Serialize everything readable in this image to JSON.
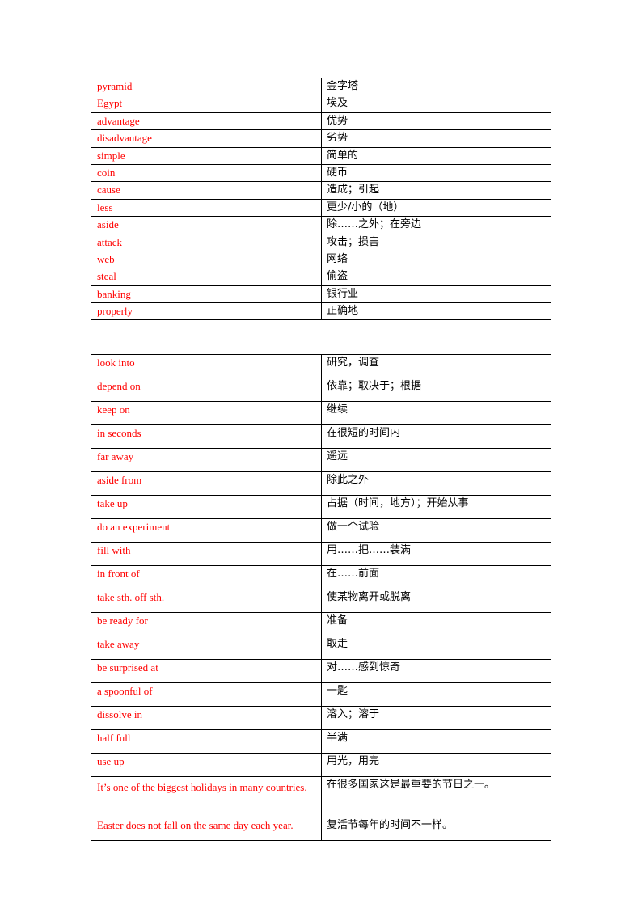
{
  "vocab_table": {
    "rows": [
      {
        "en": "pyramid",
        "zh": "金字塔"
      },
      {
        "en": "Egypt",
        "zh": "埃及"
      },
      {
        "en": "advantage",
        "zh": "优势"
      },
      {
        "en": "disadvantage",
        "zh": "劣势"
      },
      {
        "en": "simple",
        "zh": "简单的"
      },
      {
        "en": "coin",
        "zh": "硬币"
      },
      {
        "en": "cause",
        "zh": "造成；引起"
      },
      {
        "en": "less",
        "zh": "更少/小的（地）"
      },
      {
        "en": "aside",
        "zh": "除……之外；在旁边"
      },
      {
        "en": "attack",
        "zh": "攻击；损害"
      },
      {
        "en": "web",
        "zh": "网络"
      },
      {
        "en": "steal",
        "zh": "偷盗"
      },
      {
        "en": "banking",
        "zh": "银行业"
      },
      {
        "en": "properly",
        "zh": "正确地"
      }
    ]
  },
  "phrase_table": {
    "rows": [
      {
        "en": "look into",
        "zh": "研究，调查"
      },
      {
        "en": "depend on",
        "zh": "依靠；取决于；根据"
      },
      {
        "en": "keep on",
        "zh": "继续"
      },
      {
        "en": "in seconds",
        "zh": "在很短的时间内"
      },
      {
        "en": "far away",
        "zh": "遥远"
      },
      {
        "en": "aside from",
        "zh": "除此之外"
      },
      {
        "en": "take up",
        "zh": "占据（时间，地方）；开始从事"
      },
      {
        "en": "do an experiment",
        "zh": "做一个试验"
      },
      {
        "en": "fill with",
        "zh": "用……把……装满"
      },
      {
        "en": "in front of",
        "zh": "在……前面"
      },
      {
        "en": "take sth. off sth.",
        "zh": "使某物离开或脱离"
      },
      {
        "en": "be ready for",
        "zh": "准备"
      },
      {
        "en": "take away",
        "zh": "取走"
      },
      {
        "en": "be surprised at",
        "zh": "对……感到惊奇"
      },
      {
        "en": "a spoonful of",
        "zh": "一匙"
      },
      {
        "en": "dissolve in",
        "zh": "溶入；溶于"
      },
      {
        "en": "half full",
        "zh": "半满"
      },
      {
        "en": "use up",
        "zh": "用光，用完"
      },
      {
        "en": "It’s one of the biggest holidays in many countries.",
        "zh": "在很多国家这是最重要的节日之一。"
      },
      {
        "en": "Easter does not fall on the same day each year.",
        "zh": "复活节每年的时间不一样。"
      }
    ]
  }
}
